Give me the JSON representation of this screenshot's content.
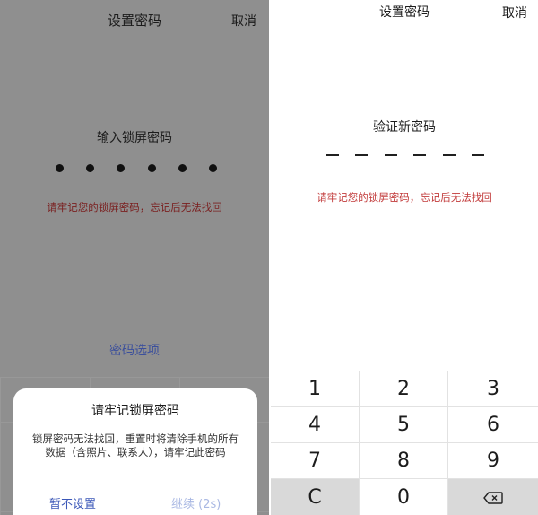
{
  "left": {
    "title": "设置密码",
    "cancel": "取消",
    "prompt": "输入锁屏密码",
    "entered_digits": 6,
    "warning": "请牢记您的锁屏密码，忘记后无法找回",
    "options": "密码选项",
    "dialog": {
      "title": "请牢记锁屏密码",
      "body": "锁屏密码无法找回，重置时将清除手机的所有数据（含照片、联系人），请牢记此密码",
      "skip": "暂不设置",
      "continue": "继续 (2s)"
    }
  },
  "right": {
    "title": "设置密码",
    "cancel": "取消",
    "prompt": "验证新密码",
    "slot_count": 6,
    "warning": "请牢记您的锁屏密码，忘记后无法找回",
    "keypad": {
      "k1": "1",
      "k2": "2",
      "k3": "3",
      "k4": "4",
      "k5": "5",
      "k6": "6",
      "k7": "7",
      "k8": "8",
      "k9": "9",
      "clear": "C",
      "k0": "0"
    }
  },
  "colors": {
    "warning_red": "#c23b3b",
    "link_blue": "#3b57b8",
    "dimmed_overlay": "#8f8f8f"
  },
  "icons": {
    "backspace": "backspace-icon"
  }
}
